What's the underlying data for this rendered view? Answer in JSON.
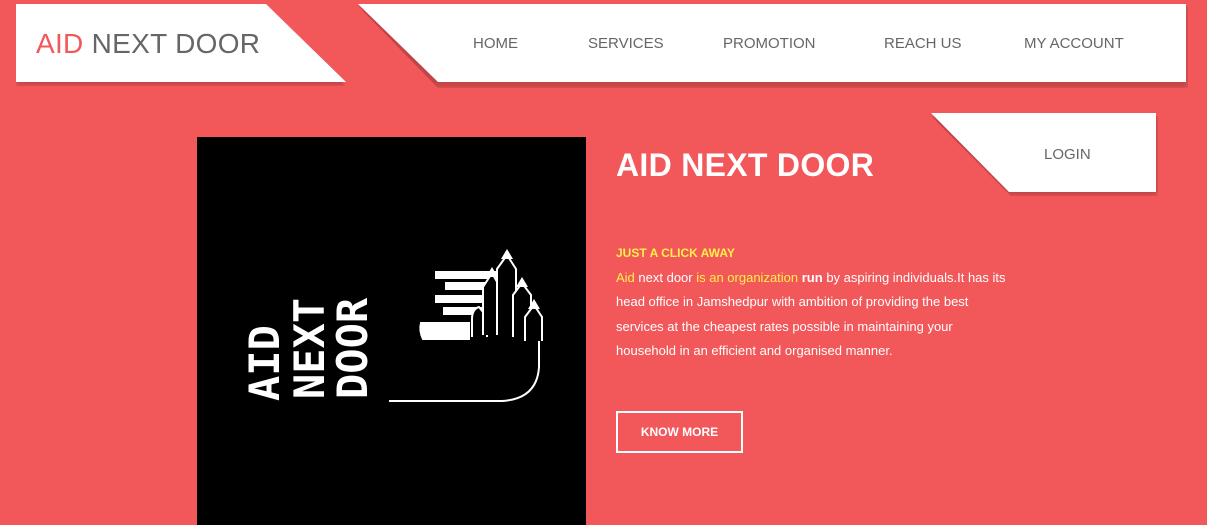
{
  "brand": {
    "accent": "AID",
    "rest": " NEXT DOOR",
    "accent_color": "#f2575a"
  },
  "nav": {
    "items": [
      {
        "label": "HOME"
      },
      {
        "label": "SERVICES"
      },
      {
        "label": "PROMOTION"
      },
      {
        "label": "REACH US"
      },
      {
        "label": "MY ACCOUNT"
      }
    ]
  },
  "login": {
    "label": "LOGIN"
  },
  "hero": {
    "title": "AID NEXT DOOR",
    "tagline": "JUST A CLICK AWAY",
    "description": {
      "part1": "Aid",
      "part2": " next door ",
      "part3": "is an organization",
      "part4": " run",
      "part5": " by aspiring individuals.It has its head office in Jamshedpur with ambition of providing the best services at the cheapest rates possible in maintaining your household in an efficient and organised manner."
    },
    "button_label": "KNOW MORE"
  },
  "logo_image": {
    "stacked_words": [
      "AID",
      "NEXT",
      "DOOR"
    ],
    "icon": "hand-with-rising-arrows-icon"
  },
  "colors": {
    "background": "#f2575a",
    "highlight": "#fff04a",
    "panel": "#ffffff",
    "nav_text": "#666666"
  }
}
